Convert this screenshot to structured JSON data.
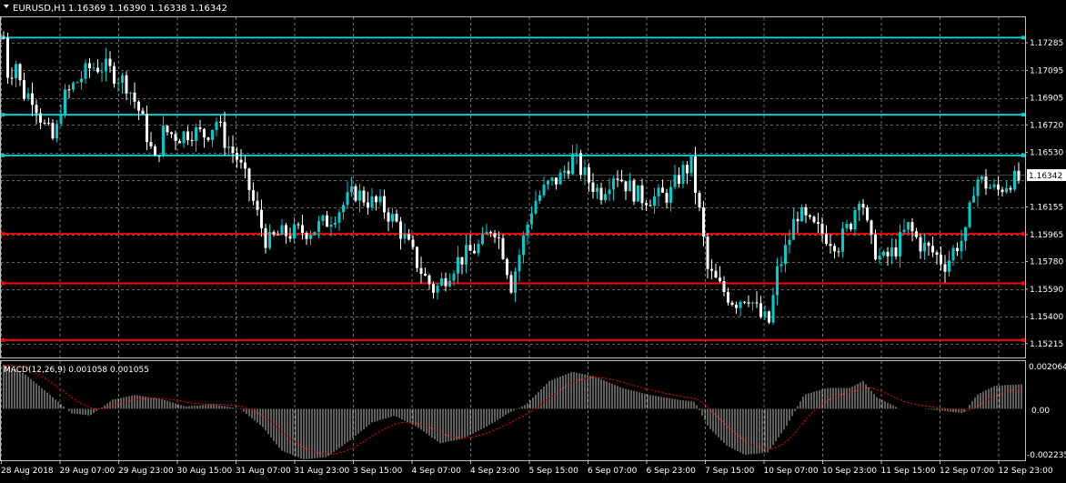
{
  "header": {
    "symbol_label": "EURUSD,H1",
    "ohlc_label": "1.16369 1.16390 1.16338 1.16342"
  },
  "macd": {
    "label": "MACD(12,26,9) 0.001058 0.001055",
    "axis_labels": [
      "0.002064",
      "0.00",
      "-0.002235"
    ]
  },
  "colors": {
    "background": "#000000",
    "grid": "#c0c0c0",
    "bull_candle": "#00cccc",
    "bear_candle": "#ffffff",
    "resistance_line": "#00cccc",
    "support_line": "#ff0000",
    "macd_hist": "#c0c0c0",
    "macd_signal": "#ff0000",
    "price_tag_bg": "#ffffff",
    "price_tag_text": "#000000",
    "text": "#ffffff"
  },
  "chart_data": [
    {
      "type": "candlestick",
      "symbol": "EURUSD",
      "timeframe": "H1",
      "ylim": [
        1.1512,
        1.1746
      ],
      "y_ticks": [
        1.17285,
        1.17095,
        1.16905,
        1.1672,
        1.1653,
        1.16342,
        1.16155,
        1.15965,
        1.1578,
        1.1559,
        1.154,
        1.15215
      ],
      "y_tick_labels": [
        "1.17285",
        "1.17095",
        "1.16905",
        "1.16720",
        "1.16530",
        "1.16342",
        "1.16155",
        "1.15965",
        "1.15780",
        "1.15590",
        "1.15400",
        "1.15215"
      ],
      "current_price": 1.16342,
      "current_price_label": "1.16342",
      "x_tick_labels": [
        "28 Aug 2018",
        "29 Aug 07:00",
        "29 Aug 23:00",
        "30 Aug 15:00",
        "31 Aug 07:00",
        "31 Aug 23:00",
        "3 Sep 15:00",
        "4 Sep 07:00",
        "4 Sep 23:00",
        "5 Sep 15:00",
        "6 Sep 07:00",
        "6 Sep 23:00",
        "7 Sep 15:00",
        "10 Sep 07:00",
        "10 Sep 23:00",
        "11 Sep 15:00",
        "12 Sep 07:00",
        "12 Sep 23:00"
      ],
      "horizontal_levels": [
        {
          "price": 1.1732,
          "kind": "resistance"
        },
        {
          "price": 1.1679,
          "kind": "resistance"
        },
        {
          "price": 1.1651,
          "kind": "resistance"
        },
        {
          "price": 1.1597,
          "kind": "support"
        },
        {
          "price": 1.1563,
          "kind": "support"
        },
        {
          "price": 1.1524,
          "kind": "support"
        }
      ],
      "close_path": [
        {
          "t": 0,
          "close": 1.1732
        },
        {
          "t": 6,
          "close": 1.17
        },
        {
          "t": 12,
          "close": 1.172
        },
        {
          "t": 20,
          "close": 1.1694
        },
        {
          "t": 32,
          "close": 1.1692
        },
        {
          "t": 44,
          "close": 1.1672
        },
        {
          "t": 56,
          "close": 1.166
        },
        {
          "t": 64,
          "close": 1.1688
        },
        {
          "t": 78,
          "close": 1.17
        },
        {
          "t": 96,
          "close": 1.1712
        },
        {
          "t": 110,
          "close": 1.1712
        },
        {
          "t": 124,
          "close": 1.1706
        },
        {
          "t": 136,
          "close": 1.17
        },
        {
          "t": 150,
          "close": 1.168
        },
        {
          "t": 160,
          "close": 1.166
        },
        {
          "t": 166,
          "close": 1.1645
        },
        {
          "t": 176,
          "close": 1.1668
        },
        {
          "t": 192,
          "close": 1.1664
        },
        {
          "t": 206,
          "close": 1.1668
        },
        {
          "t": 222,
          "close": 1.1665
        },
        {
          "t": 234,
          "close": 1.1675
        },
        {
          "t": 244,
          "close": 1.166
        },
        {
          "t": 256,
          "close": 1.165
        },
        {
          "t": 270,
          "close": 1.1628
        },
        {
          "t": 280,
          "close": 1.1608
        },
        {
          "t": 290,
          "close": 1.159
        },
        {
          "t": 300,
          "close": 1.1596
        },
        {
          "t": 320,
          "close": 1.1598
        },
        {
          "t": 340,
          "close": 1.16
        },
        {
          "t": 356,
          "close": 1.1606
        },
        {
          "t": 372,
          "close": 1.1616
        },
        {
          "t": 386,
          "close": 1.1626
        },
        {
          "t": 400,
          "close": 1.162
        },
        {
          "t": 416,
          "close": 1.1616
        },
        {
          "t": 432,
          "close": 1.1604
        },
        {
          "t": 448,
          "close": 1.1585
        },
        {
          "t": 462,
          "close": 1.1568
        },
        {
          "t": 474,
          "close": 1.1558
        },
        {
          "t": 486,
          "close": 1.1568
        },
        {
          "t": 498,
          "close": 1.1578
        },
        {
          "t": 512,
          "close": 1.1584
        },
        {
          "t": 526,
          "close": 1.159
        },
        {
          "t": 538,
          "close": 1.1604
        },
        {
          "t": 548,
          "close": 1.1588
        },
        {
          "t": 558,
          "close": 1.1562
        },
        {
          "t": 570,
          "close": 1.159
        },
        {
          "t": 582,
          "close": 1.1618
        },
        {
          "t": 598,
          "close": 1.163
        },
        {
          "t": 612,
          "close": 1.1636
        },
        {
          "t": 626,
          "close": 1.165
        },
        {
          "t": 640,
          "close": 1.1636
        },
        {
          "t": 656,
          "close": 1.1625
        },
        {
          "t": 672,
          "close": 1.164
        },
        {
          "t": 686,
          "close": 1.163
        },
        {
          "t": 700,
          "close": 1.1622
        },
        {
          "t": 716,
          "close": 1.1622
        },
        {
          "t": 732,
          "close": 1.1624
        },
        {
          "t": 746,
          "close": 1.164
        },
        {
          "t": 756,
          "close": 1.1644
        },
        {
          "t": 766,
          "close": 1.1608
        },
        {
          "t": 774,
          "close": 1.1572
        },
        {
          "t": 788,
          "close": 1.156
        },
        {
          "t": 804,
          "close": 1.155
        },
        {
          "t": 818,
          "close": 1.1556
        },
        {
          "t": 832,
          "close": 1.154
        },
        {
          "t": 842,
          "close": 1.1536
        },
        {
          "t": 850,
          "close": 1.157
        },
        {
          "t": 862,
          "close": 1.159
        },
        {
          "t": 872,
          "close": 1.1612
        },
        {
          "t": 888,
          "close": 1.1602
        },
        {
          "t": 904,
          "close": 1.1596
        },
        {
          "t": 918,
          "close": 1.159
        },
        {
          "t": 932,
          "close": 1.1606
        },
        {
          "t": 942,
          "close": 1.1628
        },
        {
          "t": 952,
          "close": 1.1592
        },
        {
          "t": 966,
          "close": 1.1578
        },
        {
          "t": 980,
          "close": 1.1586
        },
        {
          "t": 994,
          "close": 1.1602
        },
        {
          "t": 1008,
          "close": 1.159
        },
        {
          "t": 1022,
          "close": 1.1584
        },
        {
          "t": 1036,
          "close": 1.1576
        },
        {
          "t": 1046,
          "close": 1.1588
        },
        {
          "t": 1058,
          "close": 1.1596
        },
        {
          "t": 1068,
          "close": 1.1636
        },
        {
          "t": 1078,
          "close": 1.1632
        },
        {
          "t": 1092,
          "close": 1.1626
        },
        {
          "t": 1106,
          "close": 1.1634
        },
        {
          "t": 1120,
          "close": 1.1634
        }
      ],
      "t_range": [
        0,
        1120
      ]
    },
    {
      "type": "histogram",
      "indicator": "MACD",
      "params": [
        12,
        26,
        9
      ],
      "main_value": 0.001058,
      "signal_value": 0.001055,
      "ylim": [
        -0.002235,
        0.002064
      ],
      "histogram_path": [
        {
          "t": 0,
          "v": 0.0019
        },
        {
          "t": 20,
          "v": 0.0016
        },
        {
          "t": 45,
          "v": 0.0008
        },
        {
          "t": 75,
          "v": -0.0002
        },
        {
          "t": 95,
          "v": -0.0003
        },
        {
          "t": 120,
          "v": 0.0004
        },
        {
          "t": 145,
          "v": 0.0006
        },
        {
          "t": 175,
          "v": 0.0004
        },
        {
          "t": 200,
          "v": 0.0001
        },
        {
          "t": 230,
          "v": 0.0002
        },
        {
          "t": 260,
          "v": 0.0
        },
        {
          "t": 285,
          "v": -0.0008
        },
        {
          "t": 305,
          "v": -0.0018
        },
        {
          "t": 330,
          "v": -0.0022
        },
        {
          "t": 355,
          "v": -0.0021
        },
        {
          "t": 380,
          "v": -0.0014
        },
        {
          "t": 405,
          "v": -0.0006
        },
        {
          "t": 430,
          "v": -0.0003
        },
        {
          "t": 455,
          "v": -0.0008
        },
        {
          "t": 480,
          "v": -0.0015
        },
        {
          "t": 505,
          "v": -0.0013
        },
        {
          "t": 530,
          "v": -0.0008
        },
        {
          "t": 555,
          "v": -0.0002
        },
        {
          "t": 575,
          "v": 0.0002
        },
        {
          "t": 600,
          "v": 0.0012
        },
        {
          "t": 625,
          "v": 0.0016
        },
        {
          "t": 650,
          "v": 0.0014
        },
        {
          "t": 680,
          "v": 0.0009
        },
        {
          "t": 710,
          "v": 0.0006
        },
        {
          "t": 740,
          "v": 0.0004
        },
        {
          "t": 760,
          "v": 0.0003
        },
        {
          "t": 775,
          "v": -0.0008
        },
        {
          "t": 795,
          "v": -0.0016
        },
        {
          "t": 815,
          "v": -0.002
        },
        {
          "t": 840,
          "v": -0.0019
        },
        {
          "t": 860,
          "v": -0.0008
        },
        {
          "t": 880,
          "v": 0.0006
        },
        {
          "t": 905,
          "v": 0.0009
        },
        {
          "t": 930,
          "v": 0.0009
        },
        {
          "t": 945,
          "v": 0.0012
        },
        {
          "t": 960,
          "v": 0.0005
        },
        {
          "t": 985,
          "v": 0.0
        },
        {
          "t": 1010,
          "v": 0.0
        },
        {
          "t": 1035,
          "v": -0.0001
        },
        {
          "t": 1055,
          "v": -0.0002
        },
        {
          "t": 1070,
          "v": 0.0006
        },
        {
          "t": 1090,
          "v": 0.001
        },
        {
          "t": 1120,
          "v": 0.00106
        }
      ],
      "t_range": [
        0,
        1120
      ]
    }
  ]
}
